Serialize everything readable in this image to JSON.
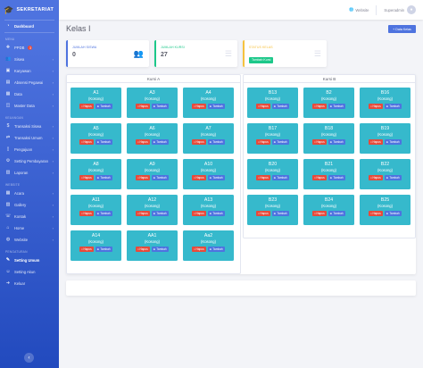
{
  "brand": {
    "name": "SEKRETARIAT",
    "icon": "graduation-cap-icon"
  },
  "sidebar": {
    "dashboard": {
      "label": "Dashboard",
      "icon": "tachometer-icon"
    },
    "section_menu": "MENU",
    "menu": [
      {
        "label": "PPDB",
        "icon": "user-plus-icon",
        "badge": "3"
      },
      {
        "label": "Siswa",
        "icon": "users-icon"
      },
      {
        "label": "Karyawan",
        "icon": "briefcase-icon"
      },
      {
        "label": "Absensi Pegawai",
        "icon": "clipboard-icon"
      },
      {
        "label": "Data",
        "icon": "table-icon"
      },
      {
        "label": "Master Data",
        "icon": "database-icon"
      }
    ],
    "section_keuangan": "KEUANGAN",
    "keuangan": [
      {
        "label": "Transaksi Siswa",
        "icon": "money-icon"
      },
      {
        "label": "Transaksi Umum",
        "icon": "exchange-icon"
      },
      {
        "label": "Pengajuan",
        "icon": "file-icon"
      },
      {
        "label": "Setting Pembayaran",
        "icon": "cog-icon"
      },
      {
        "label": "Laporan",
        "icon": "chart-icon"
      }
    ],
    "section_website": "WEBSITE",
    "website": [
      {
        "label": "Acara",
        "icon": "calendar-icon"
      },
      {
        "label": "Gallery",
        "icon": "image-icon"
      },
      {
        "label": "Kontak",
        "icon": "phone-icon"
      },
      {
        "label": "Home",
        "icon": "home-icon"
      },
      {
        "label": "Website",
        "icon": "globe-icon"
      }
    ],
    "section_pengaturan": "PENGATURAN",
    "pengaturan": [
      {
        "label": "Setting Umum",
        "icon": "wrench-icon"
      },
      {
        "label": "Setting Akun",
        "icon": "user-cog-icon"
      },
      {
        "label": "Keluar",
        "icon": "sign-out-icon"
      }
    ]
  },
  "topbar": {
    "website": "Website",
    "user": "Superadmin"
  },
  "page": {
    "title": "Kelas I",
    "add_button": "Data Kelas"
  },
  "stats": [
    {
      "label": "JUMLAH SISWA",
      "value": "0",
      "color": "#4e73df",
      "icon": "users-icon"
    },
    {
      "label": "JUMLAH KURSI",
      "value": "27",
      "color": "#1cc88a",
      "icon": "chair-icon"
    },
    {
      "label": "STATUS KELAS",
      "button": "Tambah Kursi",
      "color": "#f6c23e",
      "icon": "list-icon"
    }
  ],
  "actions": {
    "hapus": "Hapus",
    "tambah": "Tambah"
  },
  "panels": [
    {
      "title": "Kursi A",
      "desks": [
        {
          "code": "A1",
          "status": "(Kosong)"
        },
        {
          "code": "A3",
          "status": "(Kosong)"
        },
        {
          "code": "A4",
          "status": "(Kosong)"
        },
        {
          "code": "A5",
          "status": "(Kosong)"
        },
        {
          "code": "A6",
          "status": "(Kosong)"
        },
        {
          "code": "A7",
          "status": "(Kosong)"
        },
        {
          "code": "A8",
          "status": "(Kosong)"
        },
        {
          "code": "A9",
          "status": "(Kosong)"
        },
        {
          "code": "A10",
          "status": "(Kosong)"
        },
        {
          "code": "A11",
          "status": "(Kosong)"
        },
        {
          "code": "A12",
          "status": "(Kosong)"
        },
        {
          "code": "A13",
          "status": "(Kosong)"
        },
        {
          "code": "A14",
          "status": "(Kosong)"
        },
        {
          "code": "AA1",
          "status": "(Kosong)"
        },
        {
          "code": "Aa2",
          "status": "(Kosong)"
        }
      ]
    },
    {
      "title": "Kursi B",
      "desks": [
        {
          "code": "B13",
          "status": "(Kosong)"
        },
        {
          "code": "B2",
          "status": "(Kosong)"
        },
        {
          "code": "B16",
          "status": "(Kosong)"
        },
        {
          "code": "B17",
          "status": "(Kosong)"
        },
        {
          "code": "B18",
          "status": "(Kosong)"
        },
        {
          "code": "B19",
          "status": "(Kosong)"
        },
        {
          "code": "B20",
          "status": "(Kosong)"
        },
        {
          "code": "B21",
          "status": "(Kosong)"
        },
        {
          "code": "B22",
          "status": "(Kosong)"
        },
        {
          "code": "B23",
          "status": "(Kosong)"
        },
        {
          "code": "B24",
          "status": "(Kosong)"
        },
        {
          "code": "B25",
          "status": "(Kosong)"
        }
      ]
    }
  ]
}
